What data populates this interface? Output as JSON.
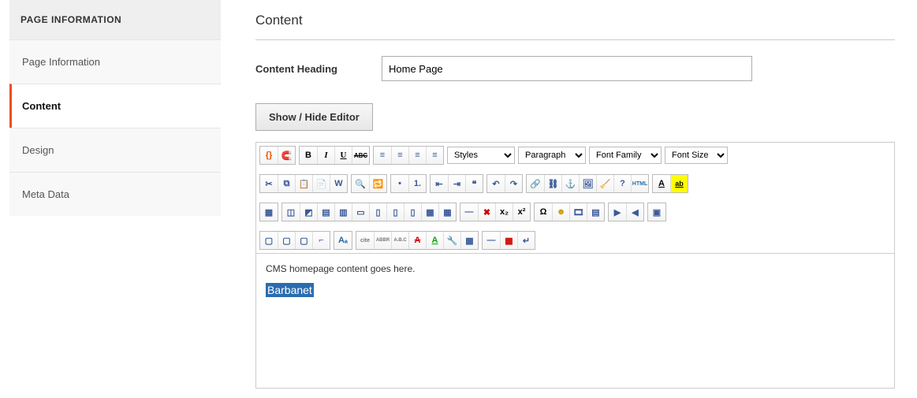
{
  "sidebar": {
    "header": "PAGE INFORMATION",
    "items": [
      {
        "label": "Page Information"
      },
      {
        "label": "Content"
      },
      {
        "label": "Design"
      },
      {
        "label": "Meta Data"
      }
    ],
    "activeIndex": 1
  },
  "content": {
    "section_title": "Content",
    "heading_label": "Content Heading",
    "heading_value": "Home Page",
    "toggle_editor_label": "Show / Hide Editor",
    "body_line1": "CMS homepage content goes here.",
    "body_selected": "Barbanet"
  },
  "toolbar": {
    "dropdowns": {
      "styles": "Styles",
      "format": "Paragraph",
      "font_family": "Font Family",
      "font_size": "Font Size"
    },
    "row1": {
      "magento_widget": "{}",
      "magento_variable": "🧲",
      "bold": "B",
      "italic": "I",
      "underline": "U",
      "strike": "ABC",
      "align_left": "≡",
      "align_center": "≡",
      "align_right": "≡",
      "justify": "≡"
    },
    "row2": {
      "cut": "✂",
      "copy": "⧉",
      "paste": "📋",
      "paste_text": "📄",
      "paste_word": "W",
      "find": "🔍",
      "replace": "🔁",
      "ul": "•",
      "ol": "1.",
      "outdent": "⇤",
      "indent": "⇥",
      "blockquote": "❝",
      "undo": "↶",
      "redo": "↷",
      "link": "🔗",
      "unlink": "⛓",
      "anchor": "⚓",
      "image": "🖼",
      "cleanup": "🧹",
      "help": "?",
      "html": "HTML",
      "textcolor": "A",
      "bgcolor": "ab"
    },
    "row3": {
      "table": "▦",
      "rowprops": "◫",
      "cellprops": "◩",
      "insrow_before": "▤",
      "insrow_after": "▥",
      "delrow": "▭",
      "inscol_before": "▯",
      "inscol_after": "▯",
      "delcol": "▯",
      "split": "▦",
      "merge": "▦",
      "hr": "—",
      "clear": "✖",
      "sub": "x₂",
      "sup": "x²",
      "char": "Ω",
      "emoticons": "☻",
      "media": "🎞",
      "flash": "▤",
      "ltr": "▶",
      "rtl": "◀",
      "fullscreen": "▣"
    },
    "row4": {
      "layer": "▢",
      "moveback": "▢",
      "movefwd": "▢",
      "abs": "⌐",
      "style": "Aₐ",
      "cite": "cite",
      "abbr": "ABBR",
      "acronym": "A.B.C",
      "del": "A",
      "ins": "A",
      "attr": "🔧",
      "vis": "▦",
      "nbsp": "—",
      "template": "▦",
      "pagebreak": "↵"
    }
  }
}
